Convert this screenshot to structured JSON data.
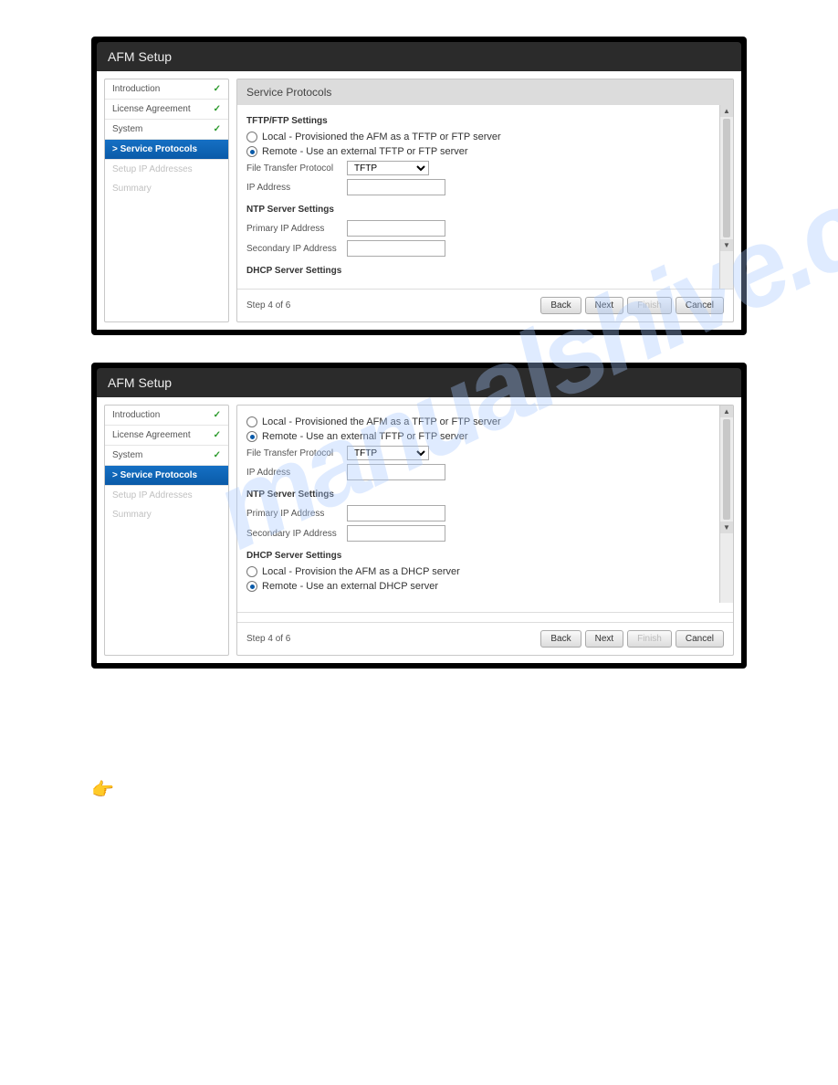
{
  "watermark": "manualshive.com",
  "win": {
    "title": "AFM Setup",
    "panelTitle": "Service Protocols",
    "step": "Step 4 of 6",
    "sidebar": {
      "items": [
        {
          "label": "Introduction",
          "done": true
        },
        {
          "label": "License Agreement",
          "done": true
        },
        {
          "label": "System",
          "done": true
        },
        {
          "label": "> Service Protocols",
          "active": true
        },
        {
          "label": "Setup IP Addresses",
          "dim": true
        },
        {
          "label": "Summary",
          "dim": true
        }
      ]
    },
    "sections": {
      "tftp": "TFTP/FTP Settings",
      "ntp": "NTP Server Settings",
      "dhcp": "DHCP Server Settings"
    },
    "radios": {
      "local": "Local - Provisioned the AFM as a TFTP or FTP server",
      "remote": "Remote - Use an external TFTP or FTP server",
      "dhcpLocal": "Local - Provision the AFM as a DHCP server",
      "dhcpRemote": "Remote - Use an external DHCP server"
    },
    "fields": {
      "ftp": "File Transfer Protocol",
      "ftpVal": "TFTP",
      "ip": "IP Address",
      "pri": "Primary IP Address",
      "sec": "Secondary IP Address"
    },
    "btns": {
      "back": "Back",
      "next": "Next",
      "finish": "Finish",
      "cancel": "Cancel"
    }
  }
}
